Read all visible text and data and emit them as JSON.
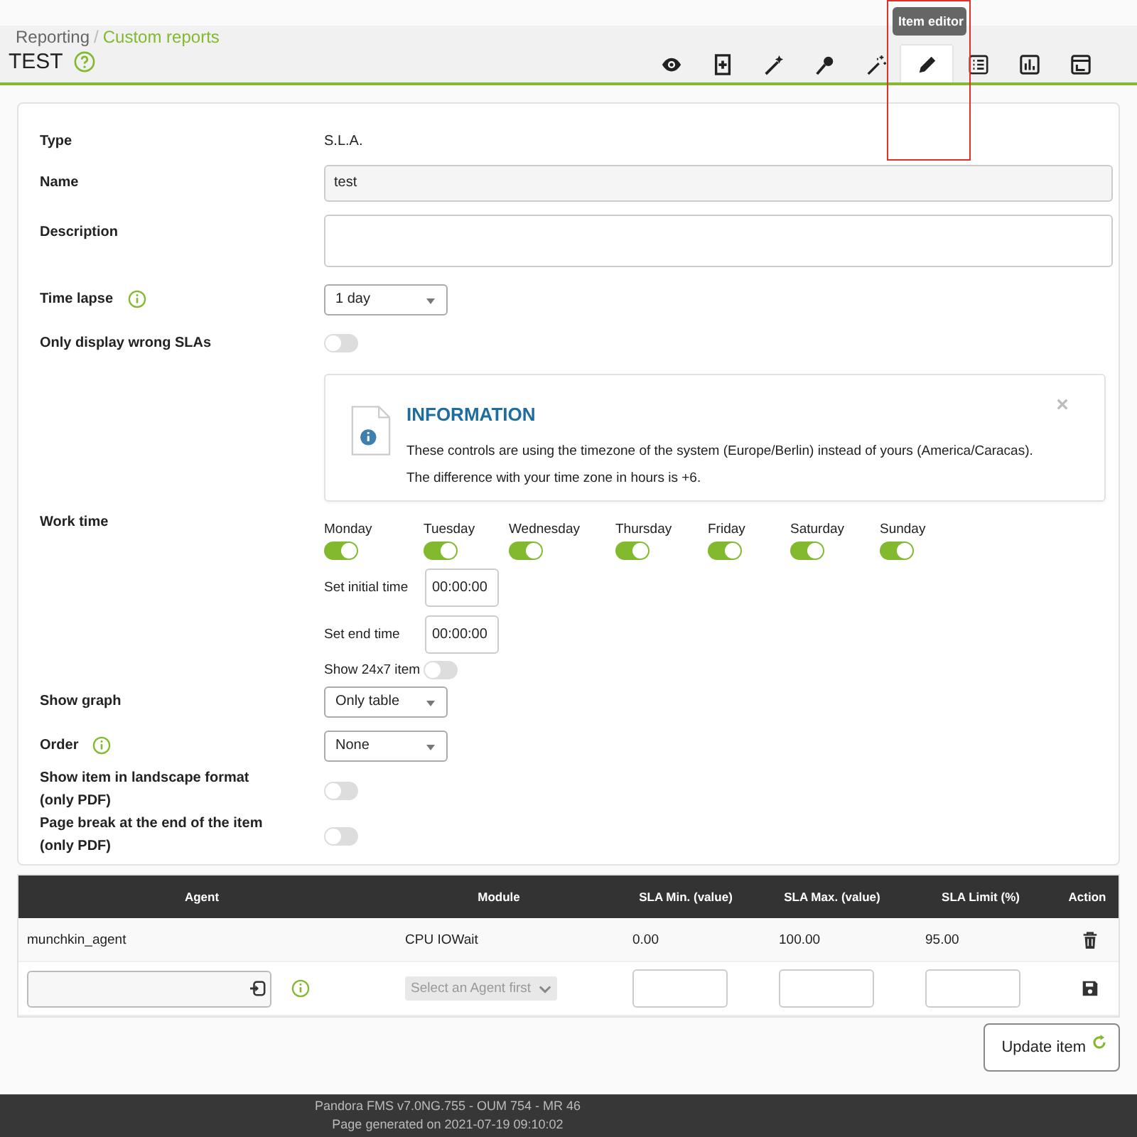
{
  "breadcrumb": {
    "parent": "Reporting",
    "separator": "/",
    "current": "Custom reports"
  },
  "title": "TEST",
  "toolbar": [
    {
      "kind": "eye",
      "selected": false
    },
    {
      "kind": "add",
      "selected": false
    },
    {
      "kind": "wand",
      "selected": false
    },
    {
      "kind": "pin",
      "selected": false
    },
    {
      "kind": "sparkle",
      "selected": false
    },
    {
      "kind": "pencil",
      "selected": true
    },
    {
      "kind": "list",
      "selected": false
    },
    {
      "kind": "chart",
      "selected": false
    },
    {
      "kind": "layout",
      "selected": false
    }
  ],
  "tooltip": "Item editor",
  "form": {
    "type": {
      "label": "Type",
      "value": "S.L.A."
    },
    "name": {
      "label": "Name",
      "value": "test"
    },
    "description": {
      "label": "Description"
    },
    "time_lapse": {
      "label": "Time lapse",
      "value": "1 day"
    },
    "only_wrong": {
      "label": "Only display wrong SLAs",
      "on": false
    },
    "work_time": {
      "label": "Work time",
      "info": {
        "title": "INFORMATION",
        "text": "These controls are using the timezone of the system (Europe/Berlin) instead of yours (America/Caracas). The difference with your time zone in hours is +6."
      },
      "days": [
        {
          "label": "Monday",
          "on": true
        },
        {
          "label": "Tuesday",
          "on": true
        },
        {
          "label": "Wednesday",
          "on": true
        },
        {
          "label": "Thursday",
          "on": true
        },
        {
          "label": "Friday",
          "on": true
        },
        {
          "label": "Saturday",
          "on": true
        },
        {
          "label": "Sunday",
          "on": true
        }
      ],
      "initial": {
        "label": "Set initial time",
        "value": "00:00:00"
      },
      "end": {
        "label": "Set end time",
        "value": "00:00:00"
      },
      "show_24x7": {
        "label": "Show 24x7 item",
        "on": false
      }
    },
    "show_graph": {
      "label": "Show graph",
      "value": "Only table"
    },
    "order": {
      "label": "Order",
      "value": "None"
    },
    "landscape": {
      "label": "Show item in landscape format (only PDF)",
      "on": false
    },
    "page_break": {
      "label": "Page break at the end of the item (only PDF)",
      "on": false
    }
  },
  "table": {
    "columns": [
      "Agent",
      "Module",
      "SLA Min. (value)",
      "SLA Max. (value)",
      "SLA Limit (%)",
      "Action"
    ],
    "rows": [
      {
        "agent": "munchkin_agent",
        "module": "CPU IOWait",
        "sla_min": "0.00",
        "sla_max": "100.00",
        "sla_limit": "95.00"
      }
    ],
    "new_row": {
      "module_placeholder": "Select an Agent first"
    }
  },
  "update_button": "Update item",
  "footer": [
    "Pandora FMS v7.0NG.755 - OUM 754 - MR 46",
    "Page generated on 2021-07-19 09:10:02"
  ]
}
